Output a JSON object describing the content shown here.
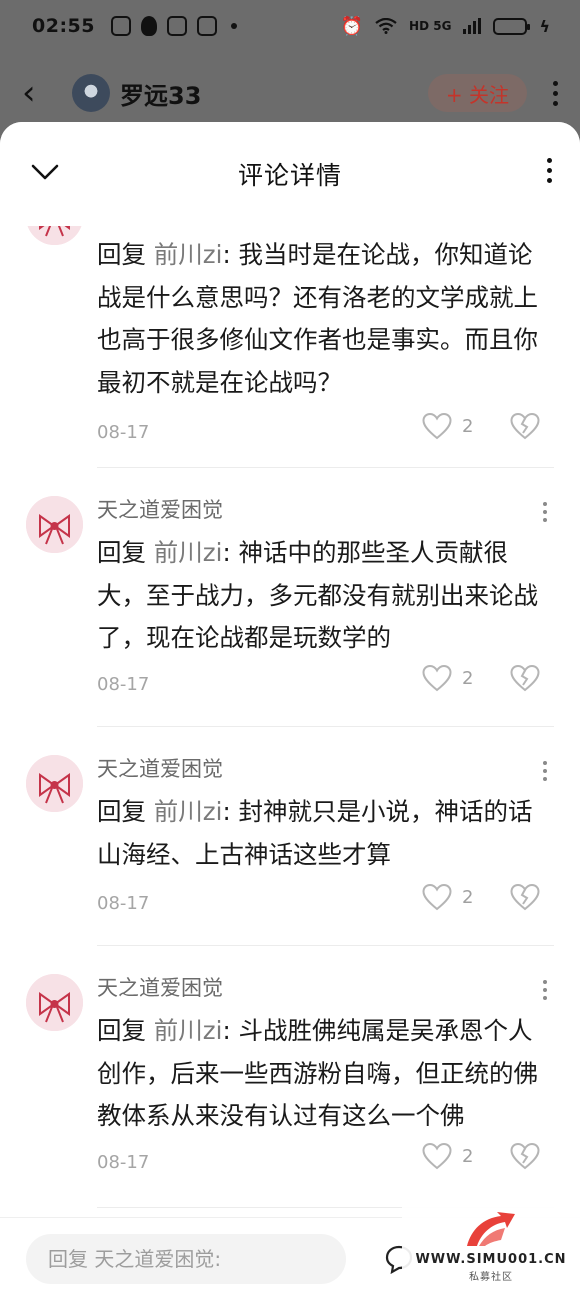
{
  "status_bar": {
    "time": "02:55",
    "network": "HD 5G"
  },
  "profile_header": {
    "name": "罗远33",
    "follow_label": "+ 关注"
  },
  "sheet": {
    "title": "评论详情"
  },
  "comments": [
    {
      "author": "",
      "reply_word": "回复",
      "mention": "前川zi",
      "text": ": 我当时是在论战，你知道论战是什么意思吗？还有洛老的文学成就上也高于很多修仙文作者也是事实。而且你最初不就是在论战吗？",
      "date": "08-17",
      "likes": "2"
    },
    {
      "author": "天之道爱困觉",
      "reply_word": "回复",
      "mention": "前川zi",
      "text": ": 神话中的那些圣人贡献很大，至于战力，多元都没有就别出来论战了，现在论战都是玩数学的",
      "date": "08-17",
      "likes": "2"
    },
    {
      "author": "天之道爱困觉",
      "reply_word": "回复",
      "mention": "前川zi",
      "text": ": 封神就只是小说，神话的话山海经、上古神话这些才算",
      "date": "08-17",
      "likes": "2"
    },
    {
      "author": "天之道爱困觉",
      "reply_word": "回复",
      "mention": "前川zi",
      "text": ": 斗战胜佛纯属是吴承恩个人创作，后来一些西游粉自嗨，但正统的佛教体系从来没有认过有这么一个佛",
      "date": "08-17",
      "likes": "2"
    }
  ],
  "input_bar": {
    "placeholder": "回复 天之道爱困觉:"
  },
  "watermark": {
    "url": "WWW.SIMU001.CN",
    "sub": "私募社区"
  },
  "colors": {
    "accent_red": "#e8413a",
    "overlay": "#6c6c6c",
    "mention_gray": "#7a7a7a"
  }
}
